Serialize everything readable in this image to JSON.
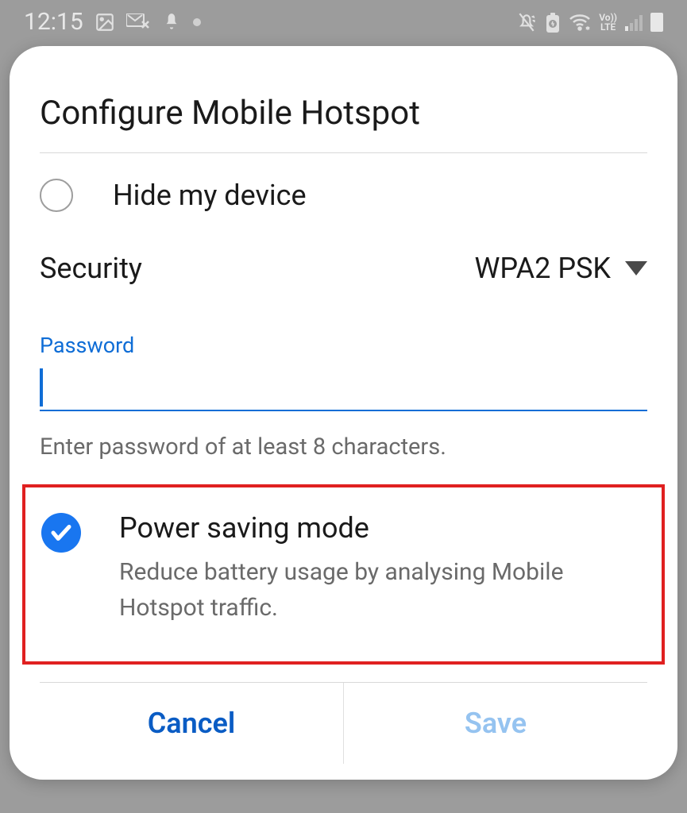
{
  "status_bar": {
    "time": "12:15"
  },
  "dialog": {
    "title": "Configure Mobile Hotspot",
    "hide_device_label": "Hide my device",
    "security": {
      "label": "Security",
      "value": "WPA2 PSK"
    },
    "password": {
      "label": "Password",
      "value": "",
      "hint": "Enter password of at least 8 characters."
    },
    "power_saving": {
      "checked": true,
      "title": "Power saving mode",
      "description": "Reduce battery usage by analysing Mobile Hotspot traffic."
    },
    "buttons": {
      "cancel": "Cancel",
      "save": "Save"
    }
  }
}
